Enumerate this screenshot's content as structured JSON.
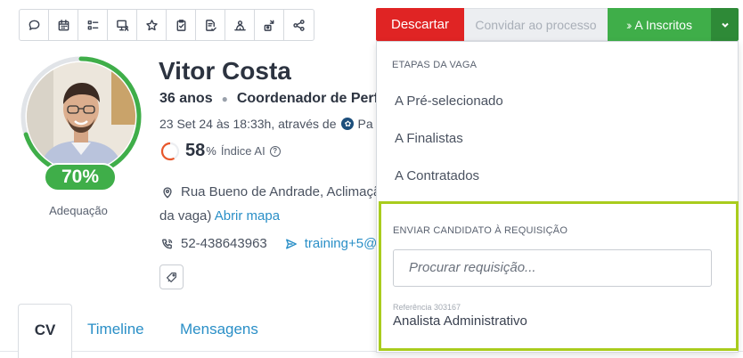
{
  "toolbar": {
    "icons": [
      "chat-bubble-icon",
      "calendar-icon",
      "checklist-icon",
      "monitor-user-icon",
      "star-icon",
      "clipboard-check-icon",
      "document-check-icon",
      "user-network-icon",
      "share-user-icon",
      "share-icon"
    ]
  },
  "candidate": {
    "name": "Vitor Costa",
    "age": "36 anos",
    "role": "Coordenador de Perf",
    "applied": "23 Set 24 às 18:33h, através de",
    "source_fragment": "Pa",
    "match_score": "70%",
    "match_score_fraction": 0.7,
    "match_label": "Adequação",
    "ai_index_value": "58",
    "ai_index_unit": "%",
    "ai_index_label": "Índice AI",
    "address": "Rua Bueno de Andrade, Aclimação",
    "address_cont": "da vaga)",
    "map_link": "Abrir mapa",
    "phone": "52-438643963",
    "email": "training+5@"
  },
  "tabs": [
    {
      "label": "CV",
      "active": true
    },
    {
      "label": "Timeline",
      "active": false
    },
    {
      "label": "Mensagens",
      "active": false
    }
  ],
  "actions": {
    "discard": "Descartar",
    "invite": "Convidar ao processo",
    "move": "A Inscritos"
  },
  "dropdown": {
    "stages_header": "ETAPAS DA VAGA",
    "stages": [
      "A Pré-selecionado",
      "A Finalistas",
      "A Contratados"
    ],
    "requisition_header": "ENVIAR CANDIDATO À REQUISIÇÃO",
    "search_placeholder": "Procurar requisição...",
    "result_ref": "Referência 303167",
    "result_title": "Analista Administrativo"
  },
  "colors": {
    "discard": "#e02424",
    "move": "#3fae49",
    "move_caret": "#2e8a37",
    "link": "#2a8fc7",
    "highlight_border": "#a9cc1d",
    "ai_ring": "#e8572b"
  }
}
